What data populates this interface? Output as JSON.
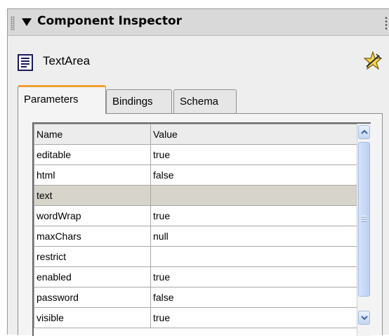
{
  "panel": {
    "title": "Component Inspector",
    "component_name": "TextArea",
    "tabs": [
      {
        "label": "Parameters",
        "active": true
      },
      {
        "label": "Bindings",
        "active": false
      },
      {
        "label": "Schema",
        "active": false
      }
    ],
    "table": {
      "columns": [
        "Name",
        "Value"
      ],
      "rows": [
        {
          "name": "editable",
          "value": "true"
        },
        {
          "name": "html",
          "value": "false"
        },
        {
          "name": "text",
          "value": "",
          "selected": true
        },
        {
          "name": "wordWrap",
          "value": "true"
        },
        {
          "name": "maxChars",
          "value": "null"
        },
        {
          "name": "restrict",
          "value": ""
        },
        {
          "name": "enabled",
          "value": "true"
        },
        {
          "name": "password",
          "value": "false"
        },
        {
          "name": "visible",
          "value": "true"
        }
      ]
    }
  },
  "icons": {
    "collapse": "triangle-down-icon",
    "component": "textarea-component-icon",
    "behaviors": "star-icon",
    "scroll_up": "chevron-up-icon",
    "scroll_down": "chevron-down-icon"
  },
  "colors": {
    "active_tab_accent": "#f0a030",
    "selected_row": "#d7d4cc",
    "scrollbar": "#c4d6f4"
  }
}
